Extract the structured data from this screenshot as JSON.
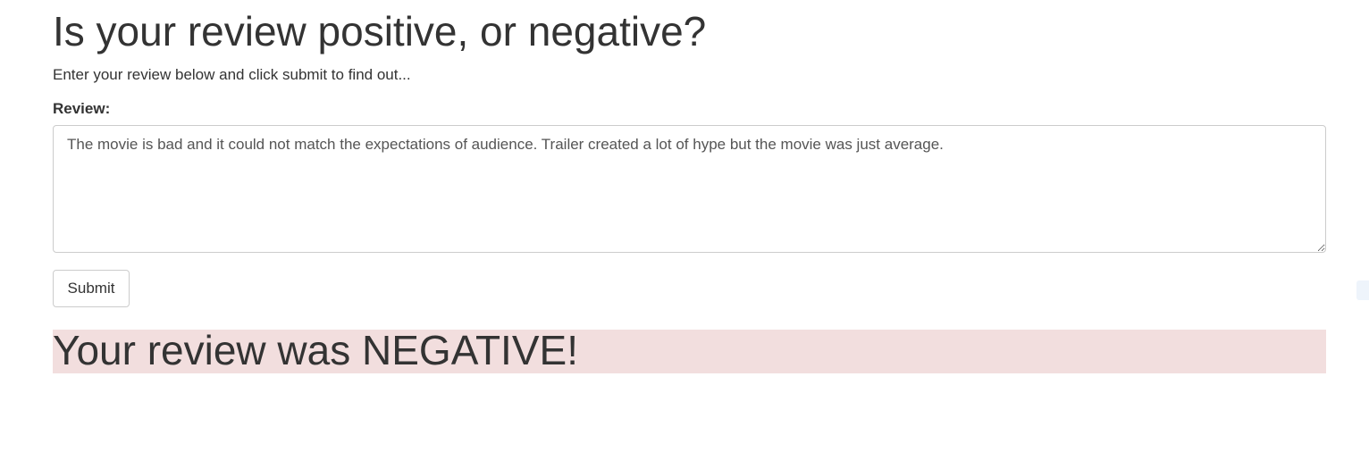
{
  "page": {
    "title": "Is your review positive, or negative?",
    "subtitle": "Enter your review below and click submit to find out..."
  },
  "form": {
    "review_label": "Review:",
    "review_value": "The movie is bad and it could not match the expectations of audience. Trailer created a lot of hype but the movie was just average.",
    "submit_label": "Submit"
  },
  "result": {
    "text": "Your review was NEGATIVE!",
    "sentiment": "negative",
    "background_color": "#f2dede"
  }
}
